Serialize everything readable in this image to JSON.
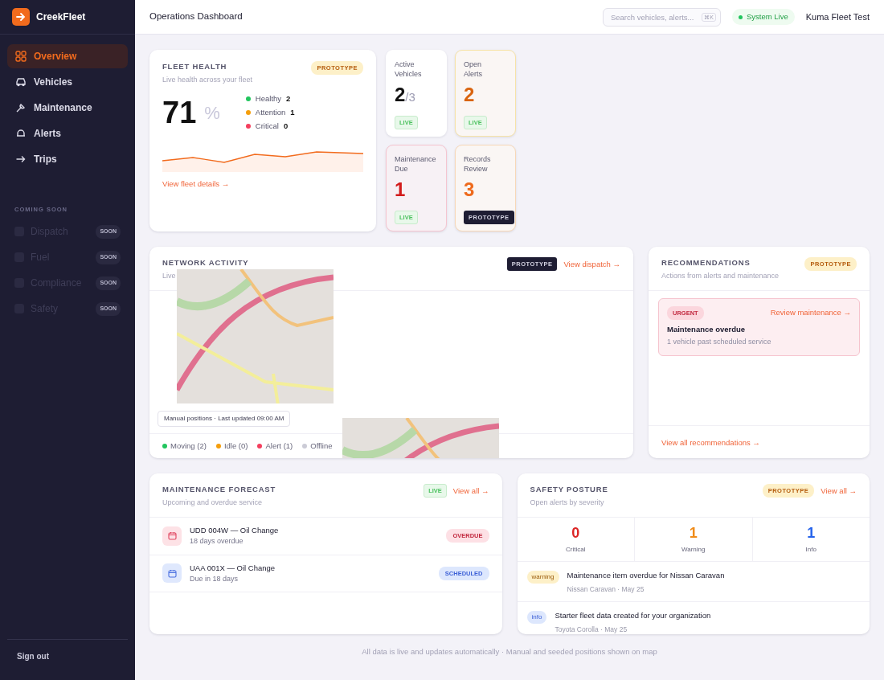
{
  "brand": {
    "name": "CreekFleet"
  },
  "sidebar": {
    "items": [
      {
        "label": "Overview",
        "selected": true
      },
      {
        "label": "Vehicles",
        "selected": false
      },
      {
        "label": "Maintenance",
        "selected": false
      },
      {
        "label": "Alerts",
        "selected": false
      },
      {
        "label": "Trips",
        "selected": false
      }
    ],
    "section_label": "COMING SOON",
    "coming_soon": [
      {
        "label": "Dispatch",
        "badge": "SOON",
        "disabled": true
      },
      {
        "label": "Fuel",
        "badge": "SOON",
        "disabled": true
      },
      {
        "label": "Compliance",
        "badge": "SOON",
        "disabled": true
      },
      {
        "label": "Safety",
        "badge": "SOON",
        "disabled": true
      }
    ],
    "sign_out": "Sign out"
  },
  "header": {
    "title": "Operations Dashboard",
    "search": {
      "placeholder": "Search vehicles, alerts...",
      "shortcut": "⌘K"
    },
    "status": "System Live",
    "org": "Kuma Fleet Test"
  },
  "fleet_health": {
    "title": "FLEET HEALTH",
    "badge": "PROTOTYPE",
    "subtitle": "Live health across your fleet",
    "score": "71",
    "unit": "%",
    "legend": [
      {
        "label": "Healthy",
        "count": "2",
        "color": "#22c55e"
      },
      {
        "label": "Attention",
        "count": "1",
        "color": "#f59e0b"
      },
      {
        "label": "Critical",
        "count": "0",
        "color": "#f43f5e"
      }
    ],
    "link": "View fleet details →"
  },
  "kpis": [
    {
      "label": "Active Vehicles",
      "value": "2",
      "suffix": "/3",
      "kind": "neutral",
      "badge": {
        "text": "LIVE",
        "kind": "live"
      }
    },
    {
      "label": "Open Alerts",
      "value": "2",
      "kind": "warning",
      "badge": {
        "text": "LIVE",
        "kind": "live"
      }
    },
    {
      "label": "Maintenance Due",
      "value": "1",
      "kind": "danger",
      "badge": {
        "text": "LIVE",
        "kind": "live"
      }
    },
    {
      "label": "Records Review",
      "value": "3",
      "kind": "attention",
      "badge": {
        "text": "PROTOTYPE",
        "kind": "prototype-dark"
      }
    }
  ],
  "network_activity": {
    "title": "NETWORK ACTIVITY",
    "subtitle": "Live",
    "badge": "PROTOTYPE",
    "link": "View dispatch →",
    "caption": "Manual positions · Last updated 09:00 AM",
    "legend": [
      {
        "label": "Moving (2)",
        "color": "#22c55e"
      },
      {
        "label": "Idle (0)",
        "color": "#f59e0b"
      },
      {
        "label": "Alert (1)",
        "color": "#f43f5e"
      },
      {
        "label": "Offline",
        "color": "#cbcbd6"
      }
    ]
  },
  "recommendations": {
    "title": "RECOMMENDATIONS",
    "subtitle": "Actions from alerts and maintenance",
    "badge": "PROTOTYPE",
    "items": [
      {
        "tag": "URGENT",
        "link": "Review maintenance →",
        "title": "Maintenance overdue",
        "detail": "1 vehicle past scheduled service"
      }
    ],
    "footer_link": "View all recommendations →"
  },
  "maintenance_forecast": {
    "title": "MAINTENANCE FORECAST",
    "subtitle": "Upcoming and overdue service",
    "badge": "LIVE",
    "link": "View all →",
    "items": [
      {
        "title": "UDD 004W — Oil Change",
        "detail": "18 days overdue",
        "status": "OVERDUE",
        "kind": "overdue"
      },
      {
        "title": "UAA 001X — Oil Change",
        "detail": "Due in 18 days",
        "status": "SCHEDULED",
        "kind": "scheduled"
      }
    ]
  },
  "safety_posture": {
    "title": "SAFETY POSTURE",
    "subtitle": "Open alerts by severity",
    "badge": "PROTOTYPE",
    "link": "View all →",
    "counts": [
      {
        "value": "0",
        "label": "Critical",
        "color": "#dc2626"
      },
      {
        "value": "1",
        "label": "Warning",
        "color": "#f08c1a"
      },
      {
        "value": "1",
        "label": "Info",
        "color": "#2563eb"
      }
    ],
    "alerts": [
      {
        "tag": "warning",
        "kind": "warning",
        "title": "Maintenance item overdue for Nissan Caravan",
        "meta": "Nissan Caravan · May 25"
      },
      {
        "tag": "info",
        "kind": "info",
        "title": "Starter fleet data created for your organization",
        "meta": "Toyota Corolla · May 25"
      }
    ]
  },
  "footer": "All data is live and updates automatically · Manual and seeded positions shown on map"
}
